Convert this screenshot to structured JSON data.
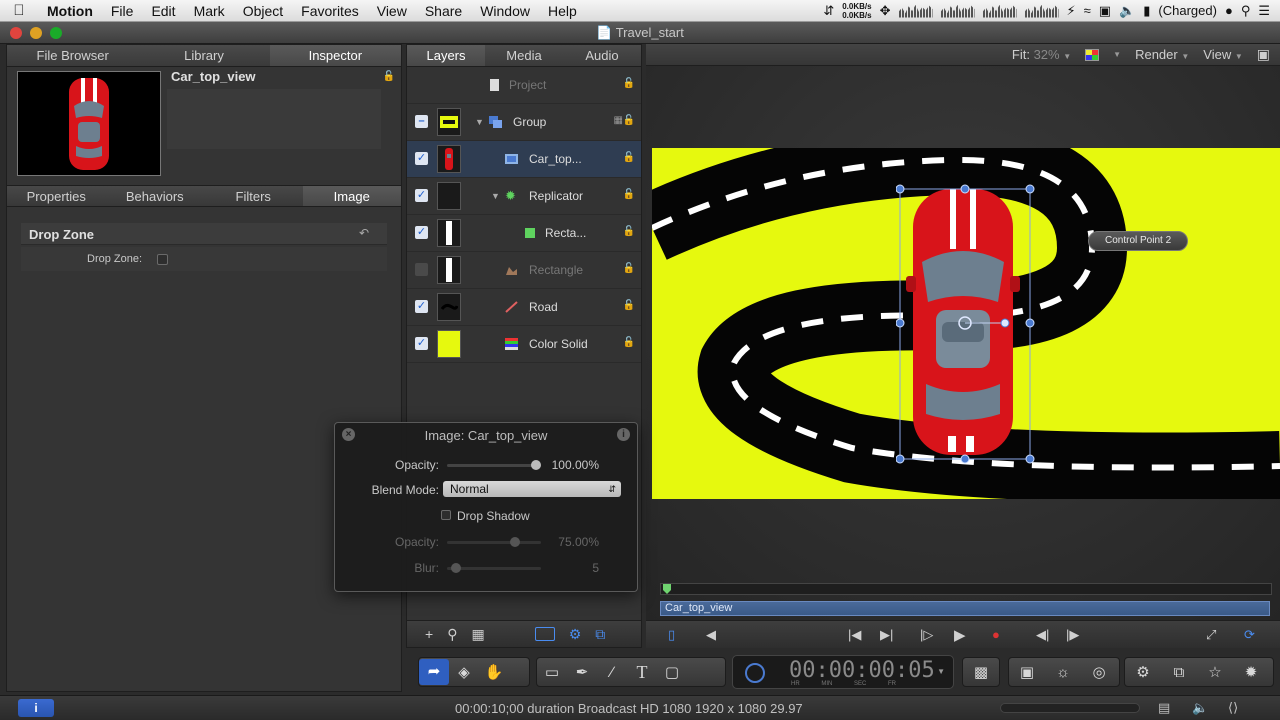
{
  "menubar": {
    "app_name": "Motion",
    "items": [
      "File",
      "Edit",
      "Mark",
      "Object",
      "Favorites",
      "View",
      "Share",
      "Window",
      "Help"
    ],
    "net_up": "0.0KB/s",
    "net_down": "0.0KB/s",
    "battery_text": "(Charged)"
  },
  "window": {
    "title": "Travel_start"
  },
  "left_panel": {
    "tabs": [
      "File Browser",
      "Library",
      "Inspector"
    ],
    "active_tab": "Inspector",
    "preview_name": "Car_top_view",
    "subtabs": [
      "Properties",
      "Behaviors",
      "Filters",
      "Image"
    ],
    "active_subtab": "Image",
    "section_title": "Drop Zone",
    "drop_zone_label": "Drop Zone:"
  },
  "layers_panel": {
    "tabs": [
      "Layers",
      "Media",
      "Audio"
    ],
    "rows": [
      {
        "name": "Project",
        "checked": "none",
        "dim": true
      },
      {
        "name": "Group",
        "checked": "mixed",
        "dim": false
      },
      {
        "name": "Car_top...",
        "checked": "on",
        "dim": false,
        "selected": true
      },
      {
        "name": "Replicator",
        "checked": "on",
        "dim": false
      },
      {
        "name": "Recta...",
        "checked": "on",
        "dim": false
      },
      {
        "name": "Rectangle",
        "checked": "off",
        "dim": true
      },
      {
        "name": "Road",
        "checked": "on",
        "dim": false
      },
      {
        "name": "Color Solid",
        "checked": "on",
        "dim": false
      }
    ]
  },
  "canvas": {
    "fit_label": "Fit:",
    "fit_value": "32%",
    "render_label": "Render",
    "view_label": "View",
    "tooltip": "Control Point 2",
    "clip_name": "Car_top_view",
    "stage_color": "#e6f90e"
  },
  "hud": {
    "title": "Image: Car_top_view",
    "opacity_label": "Opacity:",
    "opacity_value": "100.00%",
    "opacity_fraction": 1.0,
    "blend_label": "Blend Mode:",
    "blend_value": "Normal",
    "shadow_label": "Drop Shadow",
    "shadow_opacity_label": "Opacity:",
    "shadow_opacity_value": "75.00%",
    "shadow_opacity_fraction": 0.75,
    "blur_label": "Blur:",
    "blur_value": "5",
    "blur_fraction": 0.05
  },
  "timecode": {
    "value": "00:00:00:05",
    "units": "HR MIN SEC FR"
  },
  "statusbar": {
    "text": "00:00:10;00 duration Broadcast HD 1080 1920 x 1080 29.97"
  }
}
